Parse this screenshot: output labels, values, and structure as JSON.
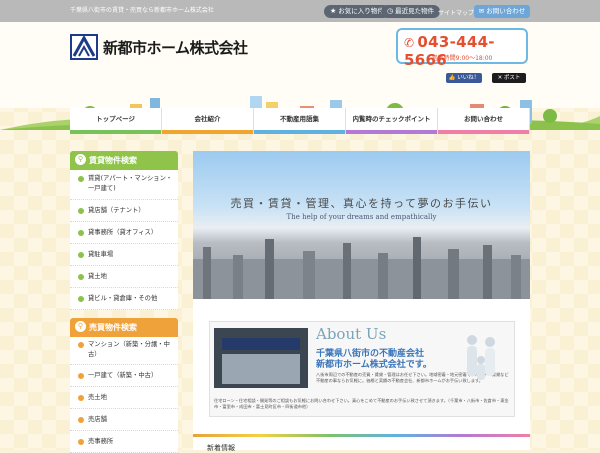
{
  "topbar": {
    "tagline": "千葉県八街市の賃貸・売買なら新都市ホーム株式会社",
    "favorites": "お気に入り物件",
    "recent": "最近見た物件",
    "sitemap": "サイトマップ",
    "contact": "お問い合わせ"
  },
  "header": {
    "logo": "新都市ホーム株式会社",
    "phone": "043-444-5666",
    "hours": "営業時間9:00～18:00",
    "fb_like": "いいね！",
    "tw_post": "ポスト"
  },
  "nav": [
    {
      "label": "トップページ",
      "color": "#77c25a"
    },
    {
      "label": "会社紹介",
      "color": "#f0a52e"
    },
    {
      "label": "不動産用語集",
      "color": "#5fb2e0"
    },
    {
      "label": "内覧時のチェックポイント",
      "color": "#b27ad4"
    },
    {
      "label": "お問い合わせ",
      "color": "#ef7fa6"
    }
  ],
  "sidebar": {
    "rent_title": "賃貸物件検索",
    "rent_color": "#8fc34a",
    "rent_items": [
      "賃貸(アパート・マンション・一戸建て)",
      "貸店舗（テナント）",
      "貸事務所（貸オフィス）",
      "貸駐車場",
      "貸土地",
      "貸ビル・貸倉庫・その他"
    ],
    "sale_title": "売買物件検索",
    "sale_color": "#f0a23a",
    "sale_items": [
      "マンション（新築・分譲・中古）",
      "一戸建て（新築・中古）",
      "売土地",
      "売店舗",
      "売事務所"
    ]
  },
  "hero": {
    "title": "売買・賃貸・管理、真心を持って夢のお手伝い",
    "subtitle": "The help of your dreams and empathically"
  },
  "about": {
    "heading": "About Us",
    "company_line1": "千葉県八街市の不動産会社",
    "company_line2": "新都市ホーム株式会社です。",
    "body": "八街市周辺での不動産の売買・賃貸・管理はお任せ下さい。地域密着・地元密着でアパート・賃貸など不動産の事ならお気軽に。価格と実績の不動産会社、新都市ホームがお手伝い致します。",
    "footer": "住宅ローン・住宅相談・開発等のご相談もお気軽にお問い合わせ下さい。真心をこめて不動産のお手伝い致させて頂きます。（千葉市・八街市・佐倉市・東金市・富里市・成田市・富士見町区市・四街道市他）"
  },
  "main_more": "新着情報"
}
